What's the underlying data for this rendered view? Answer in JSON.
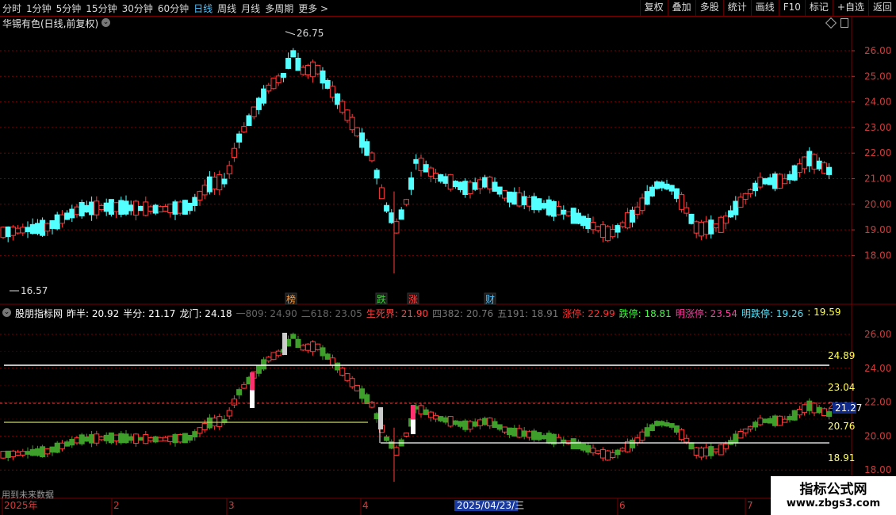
{
  "toolbar": {
    "periods": [
      "分时",
      "1分钟",
      "5分钟",
      "15分钟",
      "30分钟",
      "60分钟",
      "日线",
      "周线",
      "月线",
      "多周期",
      "更多 >"
    ],
    "active_period": "日线",
    "tools": [
      "复权",
      "叠加",
      "多股",
      "统计",
      "画线",
      "F10",
      "标记",
      "+自选",
      "返回"
    ]
  },
  "stock": {
    "title": "华锡有色(日线,前复权)"
  },
  "main_chart": {
    "high_label": "26.75",
    "low_label": "16.57",
    "y_ticks": [
      "26.00",
      "25.00",
      "24.00",
      "23.00",
      "22.00",
      "21.00",
      "20.00",
      "19.00",
      "18.00"
    ],
    "event_markers": [
      "榜",
      "跌",
      "涨",
      "财"
    ]
  },
  "indicator": {
    "items": [
      {
        "text": "股朋指标网",
        "color": "#ffffff"
      },
      {
        "text": "昨半: 20.92",
        "color": "#ffffff"
      },
      {
        "text": "半分: 21.17",
        "color": "#ffffff"
      },
      {
        "text": "龙门: 24.18",
        "color": "#ffffff"
      },
      {
        "text": "一809: 24.90",
        "color": "#666666"
      },
      {
        "text": "二618: 23.05",
        "color": "#666666"
      },
      {
        "text": "生死界: 21.90",
        "color": "#ff4040"
      },
      {
        "text": "四382: 20.76",
        "color": "#777777"
      },
      {
        "text": "五191: 18.91",
        "color": "#777777"
      },
      {
        "text": "涨停: 22.99",
        "color": "#ff3030"
      },
      {
        "text": "跌停: 18.81",
        "color": "#38ff38"
      },
      {
        "text": "明涨停: 23.54",
        "color": "#ff3aa0"
      },
      {
        "text": "明跌停: 19.26",
        "color": "#4ee6ff"
      },
      {
        "text": ": 19.59",
        "color": "#ffff40"
      }
    ],
    "y_ticks": [
      "26.00",
      "24.00",
      "22.00",
      "20.00",
      "18.00"
    ],
    "level_labels": [
      {
        "text": "24.89",
        "color": "#ffff60"
      },
      {
        "text": "23.04",
        "color": "#ffff60"
      },
      {
        "text": "21.90",
        "color": "#ff3030"
      },
      {
        "text": "20.76",
        "color": "#ffff60"
      },
      {
        "text": "18.91",
        "color": "#ffff60"
      }
    ],
    "current_price": "21.27"
  },
  "x_axis": {
    "labels": [
      "2025年",
      "2",
      "3",
      "4",
      "6",
      "7"
    ],
    "cursor_date": "2025/04/23/三"
  },
  "future_note": "用到未来数据",
  "watermark": {
    "title": "指标公式网",
    "url": "www.zbgs3.com"
  },
  "colors": {
    "up": "#ff3a3a",
    "down": "#54ffff",
    "grid": "#7a0000",
    "background": "#000000"
  }
}
